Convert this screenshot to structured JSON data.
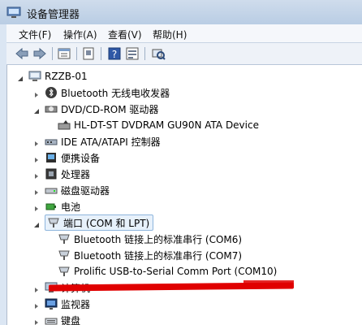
{
  "window": {
    "title": "设备管理器",
    "icon": "device-manager-icon"
  },
  "menu": [
    "文件(F)",
    "操作(A)",
    "查看(V)",
    "帮助(H)"
  ],
  "toolbar": {
    "buttons": [
      "back-arrow-icon",
      "forward-arrow-icon",
      "properties-icon",
      "update-driver-icon",
      "help-icon",
      "show-hidden-icon",
      "scan-hardware-icon"
    ]
  },
  "tree": {
    "root": "RZZB-01",
    "items": [
      {
        "label": "Bluetooth 无线电收发器",
        "icon": "bluetooth-icon",
        "expanded": false
      },
      {
        "label": "DVD/CD-ROM 驱动器",
        "icon": "dvd-drive-icon",
        "expanded": true
      },
      {
        "label": "HL-DT-ST DVDRAM GU90N ATA Device",
        "icon": "dvd-drive-icon",
        "child": true
      },
      {
        "label": "IDE ATA/ATAPI 控制器",
        "icon": "ide-controller-icon",
        "expanded": false
      },
      {
        "label": "便携设备",
        "icon": "portable-device-icon",
        "expanded": false
      },
      {
        "label": "处理器",
        "icon": "processor-icon",
        "expanded": false
      },
      {
        "label": "磁盘驱动器",
        "icon": "disk-drive-icon",
        "expanded": false
      },
      {
        "label": "电池",
        "icon": "battery-icon",
        "expanded": false
      },
      {
        "label": "端口 (COM 和 LPT)",
        "icon": "port-icon",
        "expanded": true,
        "selected": true
      },
      {
        "label": "Bluetooth 链接上的标准串行 (COM6)",
        "icon": "port-icon",
        "child": true
      },
      {
        "label": "Bluetooth 链接上的标准串行 (COM7)",
        "icon": "port-icon",
        "child": true
      },
      {
        "label": "Prolific USB-to-Serial Comm Port (COM10)",
        "icon": "port-icon",
        "child": true
      },
      {
        "label": "计算机",
        "icon": "computer-icon",
        "expanded": false
      },
      {
        "label": "监视器",
        "icon": "monitor-icon",
        "expanded": false
      },
      {
        "label": "键盘",
        "icon": "keyboard-icon",
        "expanded": false
      }
    ]
  },
  "colors": {
    "redaction": "#e00000",
    "selection": "#e7f1fb"
  }
}
